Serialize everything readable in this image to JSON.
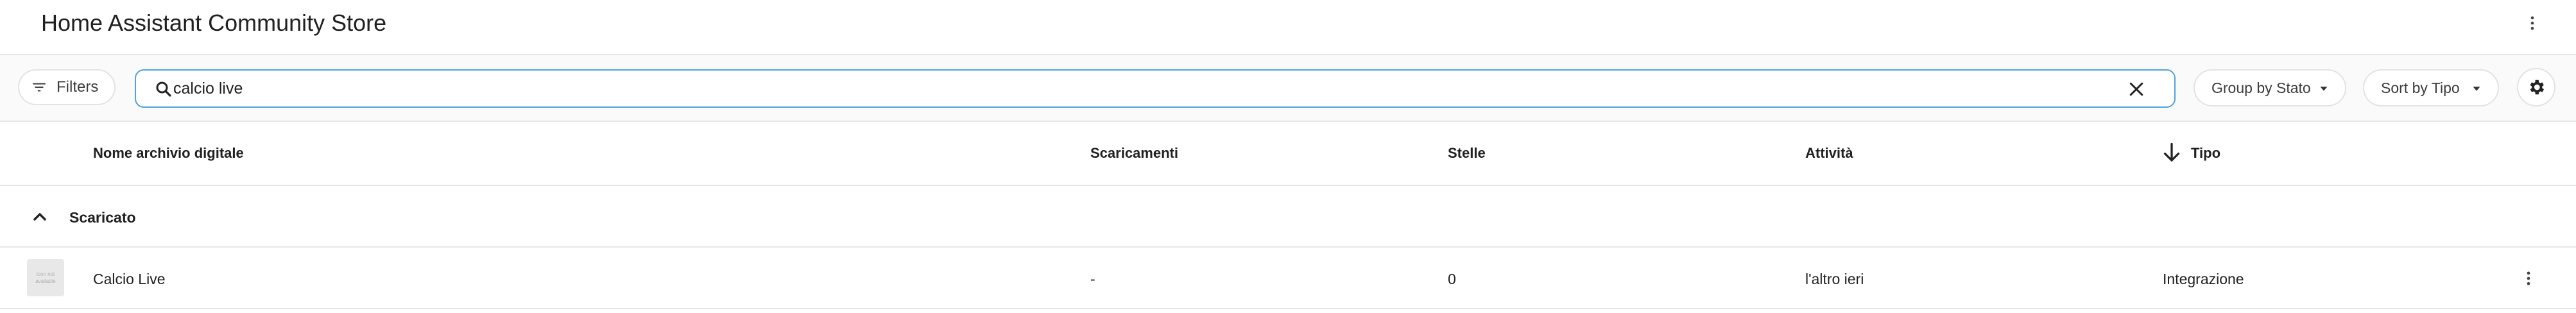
{
  "header": {
    "title": "Home Assistant Community Store"
  },
  "toolbar": {
    "filters_label": "Filters",
    "search_value": "calcio live",
    "group_label": "Group by Stato",
    "sort_label": "Sort by Tipo"
  },
  "table": {
    "columns": [
      "Nome archivio digitale",
      "Scaricamenti",
      "Stelle",
      "Attività",
      "Tipo"
    ],
    "sorted_column": "Tipo",
    "sort_direction": "descending",
    "groups": [
      {
        "label": "Scaricato",
        "expanded": true,
        "rows": [
          {
            "thumbnail_text": "Icon not available",
            "name": "Calcio Live",
            "downloads": "-",
            "stars": "0",
            "activity": "l'altro ieri",
            "type": "Integrazione"
          }
        ]
      }
    ]
  },
  "icons": {
    "header_menu": "more-vertical-icon",
    "filters": "filter-list-icon",
    "search": "magnify-icon",
    "clear": "close-icon",
    "dropdown": "caret-down-icon",
    "settings": "gear-icon",
    "sort": "arrow-down-icon",
    "group_toggle": "chevron-up-icon",
    "row_menu": "more-vertical-icon"
  },
  "colors": {
    "search_border": "#4fa3d8",
    "toolbar_bg": "#fafafa",
    "divider": "#e6e6e6"
  }
}
